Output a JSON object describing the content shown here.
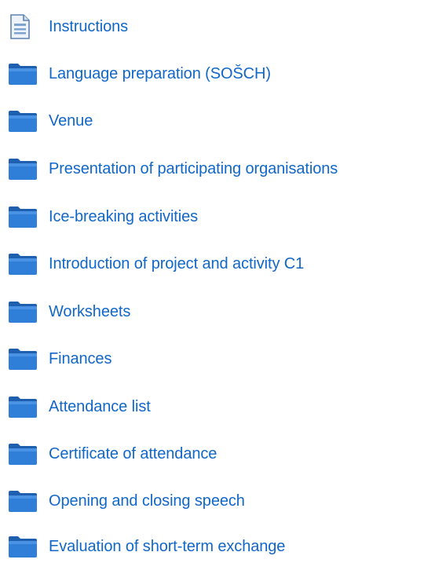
{
  "colors": {
    "link": "#1167c8",
    "folder_body": "#2f7ed8",
    "folder_tab": "#1f5fb0",
    "document_border": "#5d83b3"
  },
  "items": [
    {
      "label": "Instructions",
      "icon": "document-icon"
    },
    {
      "label": "Language preparation (SOŠCH)",
      "icon": "folder-icon"
    },
    {
      "label": "Venue",
      "icon": "folder-icon"
    },
    {
      "label": "Presentation of participating organisations",
      "icon": "folder-icon"
    },
    {
      "label": "Ice-breaking activities",
      "icon": "folder-icon"
    },
    {
      "label": "Introduction of project and activity C1",
      "icon": "folder-icon"
    },
    {
      "label": "Worksheets",
      "icon": "folder-icon"
    },
    {
      "label": "Finances",
      "icon": "folder-icon"
    },
    {
      "label": "Attendance list",
      "icon": "folder-icon"
    },
    {
      "label": "Certificate of attendance",
      "icon": "folder-icon"
    },
    {
      "label": "Opening and closing speech",
      "icon": "folder-icon"
    },
    {
      "label": "Evaluation of short-term exchange",
      "icon": "folder-icon"
    }
  ]
}
